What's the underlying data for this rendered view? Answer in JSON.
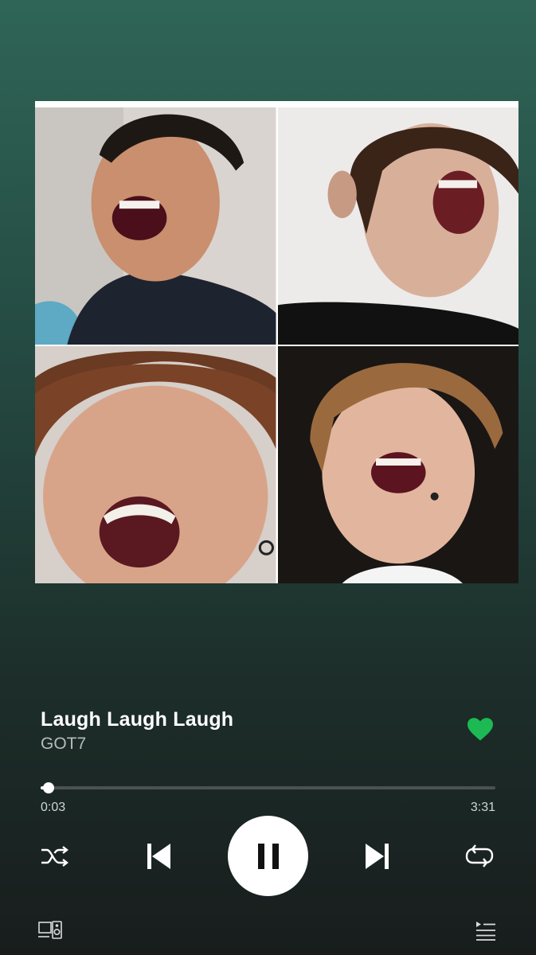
{
  "track": {
    "title": "Laugh Laugh Laugh",
    "artist": "GOT7",
    "liked": true
  },
  "playback": {
    "elapsed": "0:03",
    "duration": "3:31",
    "progress_fraction": 0.017,
    "state": "playing"
  },
  "controls": [
    "shuffle-icon",
    "previous-icon",
    "pause-icon",
    "next-icon",
    "repeat-icon"
  ],
  "footer": [
    "devices-icon",
    "queue-icon"
  ],
  "colors": {
    "accent": "#1DB954",
    "background_top": "#2f6556",
    "background_bottom": "#181d1c"
  }
}
